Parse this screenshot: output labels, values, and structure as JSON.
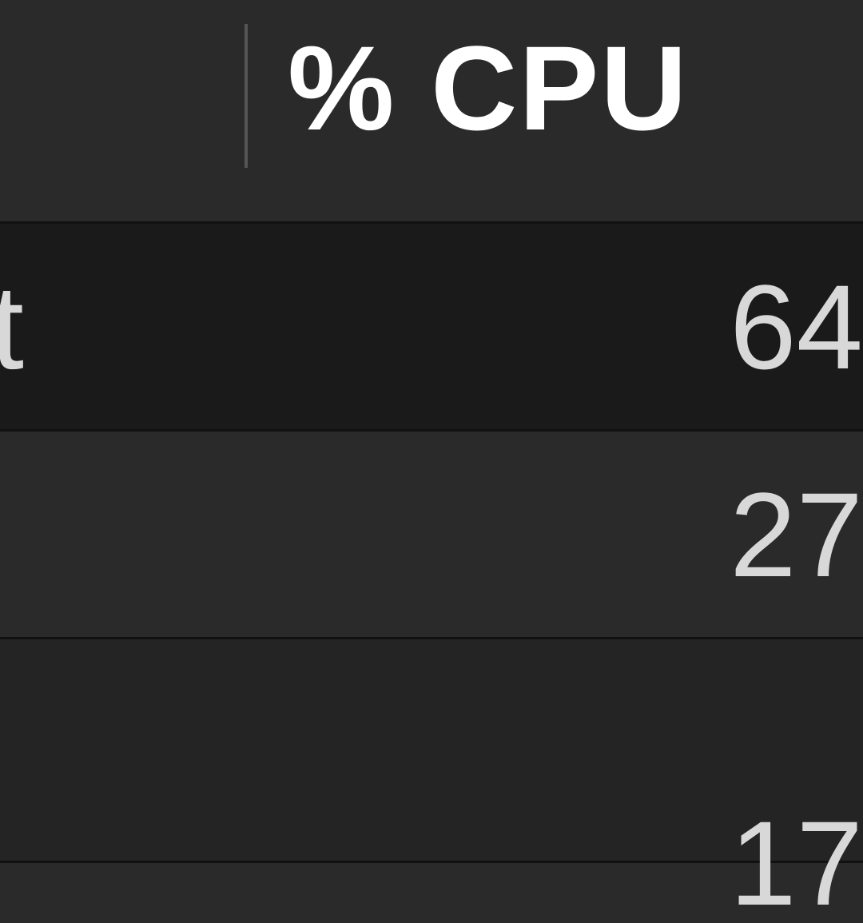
{
  "header": {
    "column_process": "",
    "column_cpu": "% CPU"
  },
  "rows": [
    {
      "process_name": "rkit",
      "cpu_value": "64"
    },
    {
      "process_name": "",
      "cpu_value": "27"
    },
    {
      "process_name": "",
      "cpu_value": "17"
    }
  ]
}
